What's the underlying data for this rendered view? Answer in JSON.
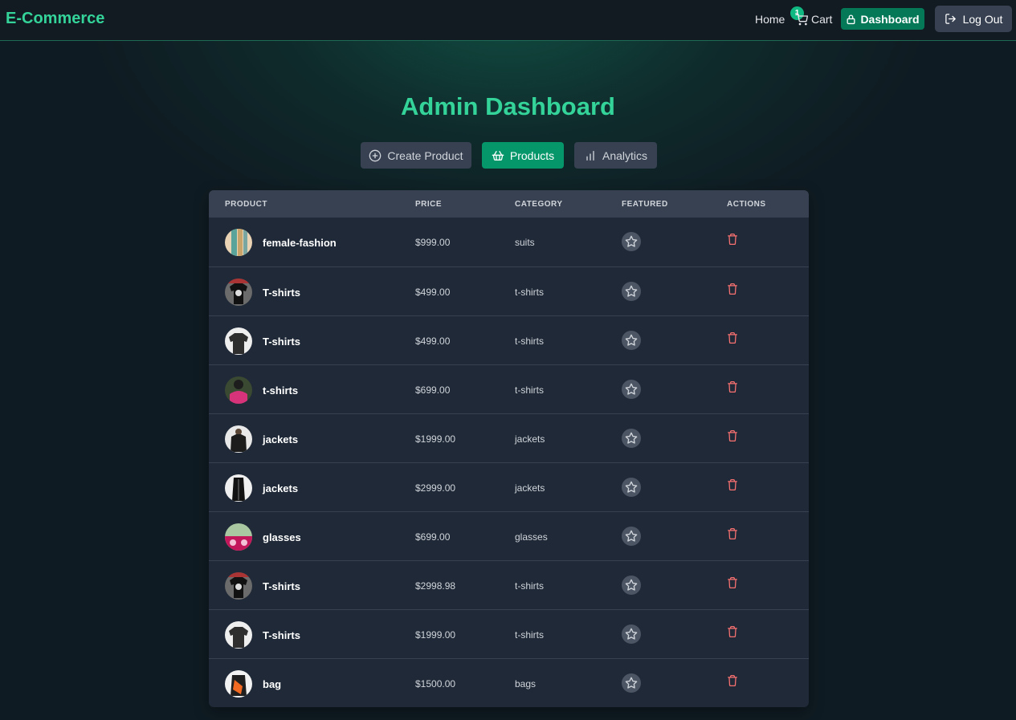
{
  "header": {
    "brand": "E-Commerce",
    "home": "Home",
    "cart_label": "Cart",
    "cart_count": "1",
    "dashboard": "Dashboard",
    "logout": "Log Out"
  },
  "page_title": "Admin Dashboard",
  "tabs": [
    {
      "label": "Create Product",
      "icon": "plus-circle-icon",
      "active": false
    },
    {
      "label": "Products",
      "icon": "basket-icon",
      "active": true
    },
    {
      "label": "Analytics",
      "icon": "bar-chart-icon",
      "active": false
    }
  ],
  "table": {
    "columns": [
      "PRODUCT",
      "PRICE",
      "CATEGORY",
      "FEATURED",
      "ACTIONS"
    ],
    "rows": [
      {
        "name": "female-fashion",
        "price": "$999.00",
        "category": "suits",
        "thumb": "fashion"
      },
      {
        "name": "T-shirts",
        "price": "$499.00",
        "category": "t-shirts",
        "thumb": "tshirt-dark"
      },
      {
        "name": "T-shirts",
        "price": "$499.00",
        "category": "t-shirts",
        "thumb": "tshirt-white"
      },
      {
        "name": "t-shirts",
        "price": "$699.00",
        "category": "t-shirts",
        "thumb": "tshirt-pink"
      },
      {
        "name": "jackets",
        "price": "$1999.00",
        "category": "jackets",
        "thumb": "jacket"
      },
      {
        "name": "jackets",
        "price": "$2999.00",
        "category": "jackets",
        "thumb": "jacket-black"
      },
      {
        "name": "glasses",
        "price": "$699.00",
        "category": "glasses",
        "thumb": "glasses"
      },
      {
        "name": "T-shirts",
        "price": "$2998.98",
        "category": "t-shirts",
        "thumb": "tshirt-dark"
      },
      {
        "name": "T-shirts",
        "price": "$1999.00",
        "category": "t-shirts",
        "thumb": "tshirt-white"
      },
      {
        "name": "bag",
        "price": "$1500.00",
        "category": "bags",
        "thumb": "bag"
      }
    ]
  },
  "colors": {
    "accent": "#34d399",
    "active_tab": "#059669",
    "dashboard_btn": "#047857",
    "delete": "#f87171"
  }
}
